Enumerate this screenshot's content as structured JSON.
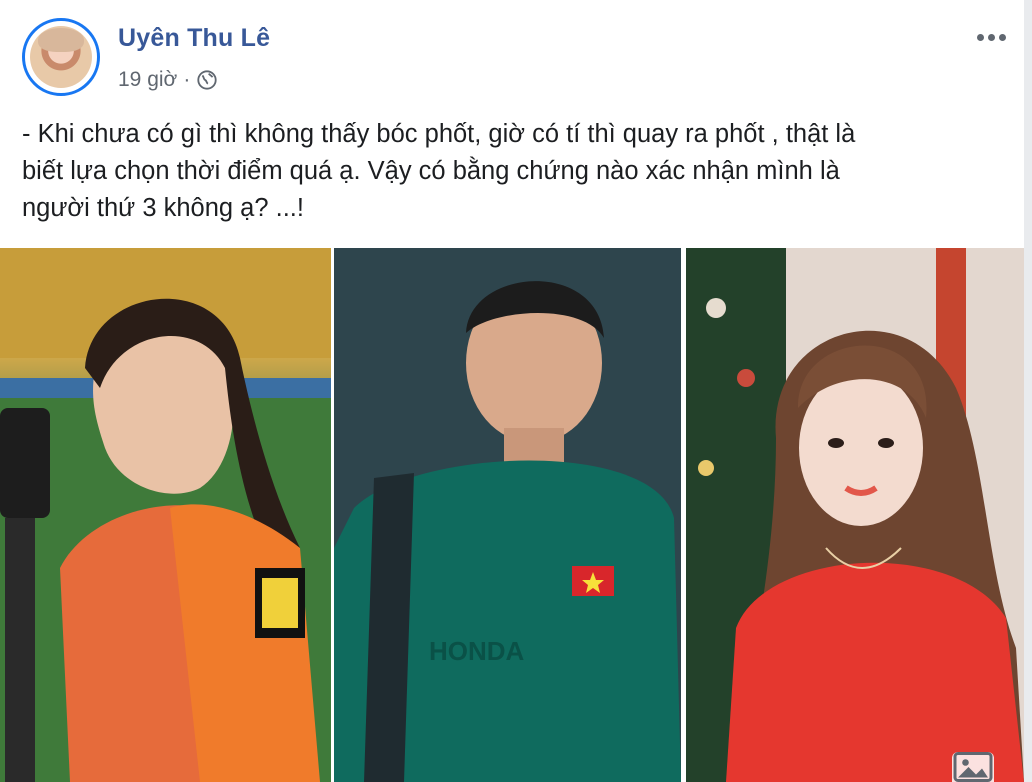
{
  "post": {
    "author": "Uyên Thu Lê",
    "time": "19 giờ",
    "separator": "·",
    "privacy_icon": "globe-icon",
    "more_icon": "more-horizontal-icon",
    "text_lines": [
      "- Khi chưa có gì thì không thấy bóc phốt, giờ có tí thì quay ra phốt , thật là",
      "biết lựa chọn thời điểm quá ạ. Vậy có bằng chứng nào xác nhận mình là",
      "người thứ 3 không ạ? ...!"
    ],
    "photos": [
      {
        "subject": "woman-photographer-orange-vest"
      },
      {
        "subject": "footballer-green-jersey"
      },
      {
        "subject": "woman-red-sweater"
      }
    ]
  },
  "colors": {
    "author_link": "#385898",
    "meta_text": "#606770",
    "body_text": "#1c1e21",
    "avatar_ring": "#1877f2"
  }
}
